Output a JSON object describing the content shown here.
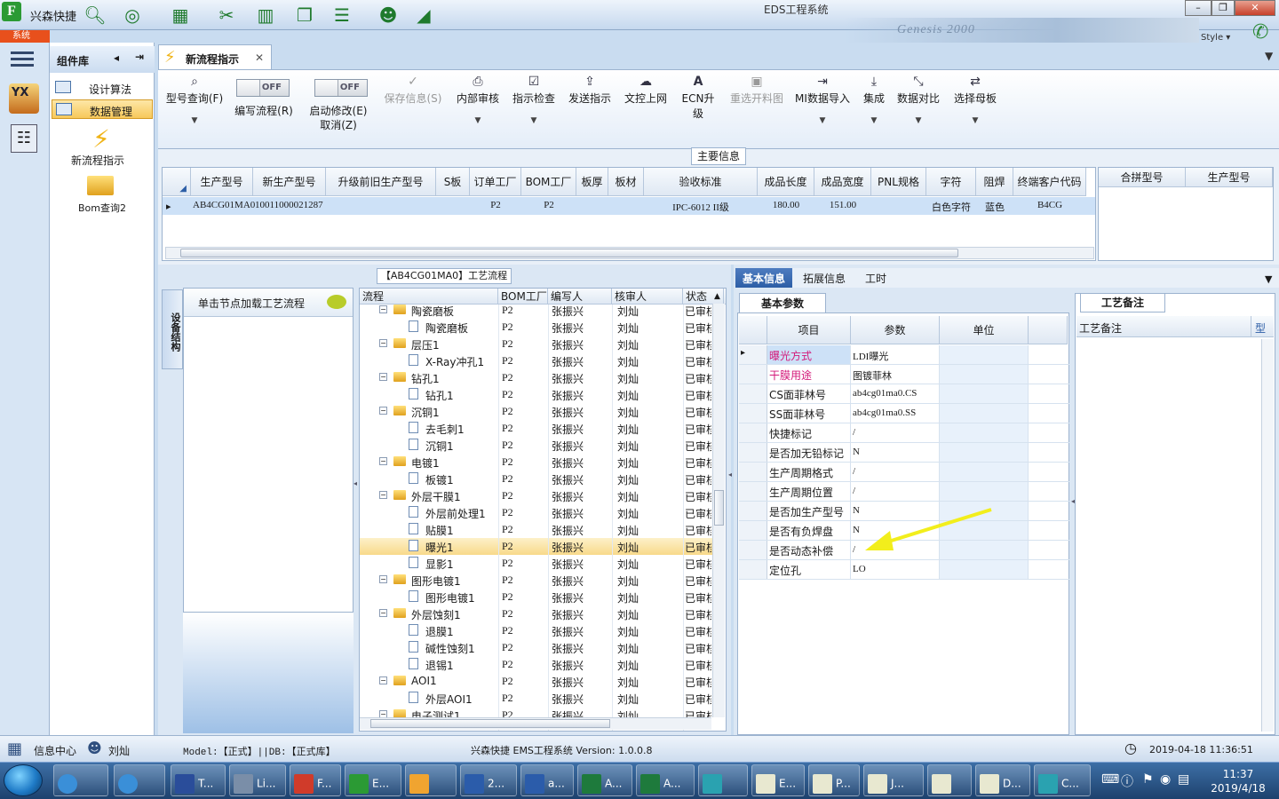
{
  "window": {
    "title": "EDS工程系统",
    "app_name": "兴森快捷",
    "style_label": "Style",
    "banner_text": "Genesis 2000"
  },
  "system_tab": "系统",
  "sidebar": {
    "header": "组件库",
    "items": [
      {
        "label": "设计算法",
        "selected": false
      },
      {
        "label": "数据管理",
        "selected": true
      }
    ],
    "tools": [
      {
        "label": "新流程指示"
      },
      {
        "label": "Bom查询2"
      }
    ]
  },
  "doc_tab": {
    "label": "新流程指示"
  },
  "ribbon": {
    "buttons": [
      {
        "label": "型号查询(F)",
        "icon": "search-icon",
        "enabled": true
      },
      {
        "label": "编写流程(R)",
        "toggle": "OFF",
        "enabled": true
      },
      {
        "label": "启动修改(E)",
        "toggle": "OFF",
        "sub": "取消(Z)",
        "enabled": true
      },
      {
        "label": "保存信息(S)",
        "icon": "check-icon",
        "enabled": false
      },
      {
        "label": "内部审核",
        "icon": "print-icon",
        "enabled": true
      },
      {
        "label": "指示检查",
        "icon": "checkbox-icon",
        "enabled": true
      },
      {
        "label": "发送指示",
        "icon": "upload-icon",
        "enabled": true
      },
      {
        "label": "文控上网",
        "icon": "cloud-upload-icon",
        "enabled": true
      },
      {
        "label": "ECN升级",
        "icon": "ecn-icon",
        "enabled": true
      },
      {
        "label": "重选开料图",
        "icon": "image-icon",
        "enabled": false
      },
      {
        "label": "MI数据导入",
        "icon": "import-icon",
        "enabled": true
      },
      {
        "label": "集成",
        "icon": "download-icon",
        "enabled": true
      },
      {
        "label": "数据对比",
        "icon": "compare-icon",
        "enabled": true
      },
      {
        "label": "选择母板",
        "icon": "shuffle-icon",
        "enabled": true
      }
    ]
  },
  "main_info": {
    "title": "主要信息",
    "columns": [
      "生产型号",
      "新生产型号",
      "升级前旧生产型号",
      "S板",
      "订单工厂",
      "BOM工厂",
      "板厚",
      "板材",
      "验收标准",
      "成品长度",
      "成品宽度",
      "PNL规格",
      "字符",
      "阻焊",
      "终端客户代码"
    ],
    "row": [
      "AB4CG01MA0",
      "10011000021287",
      "",
      "",
      "P2",
      "P2",
      "",
      "",
      "IPC-6012 II级",
      "180.00",
      "151.00",
      "",
      "白色字符",
      "蓝色",
      "B4CG"
    ],
    "side_columns": [
      "合拼型号",
      "生产型号"
    ]
  },
  "process": {
    "title": "【AB4CG01MA0】工艺流程",
    "vertical_tab": "设备结构",
    "left_header": "单击节点加载工艺流程",
    "columns": [
      "流程",
      "BOM工厂",
      "编写人",
      "核审人",
      "状态"
    ],
    "rows": [
      {
        "name": "陶瓷磨板",
        "level": 0,
        "bom": "P2",
        "author": "张振兴",
        "reviewer": "刘灿",
        "status": "已审核"
      },
      {
        "name": "陶瓷磨板",
        "level": 1,
        "bom": "P2",
        "author": "张振兴",
        "reviewer": "刘灿",
        "status": "已审核"
      },
      {
        "name": "层压1",
        "level": 0,
        "bom": "P2",
        "author": "张振兴",
        "reviewer": "刘灿",
        "status": "已审核"
      },
      {
        "name": "X-Ray冲孔1",
        "level": 1,
        "bom": "P2",
        "author": "张振兴",
        "reviewer": "刘灿",
        "status": "已审核"
      },
      {
        "name": "钻孔1",
        "level": 0,
        "bom": "P2",
        "author": "张振兴",
        "reviewer": "刘灿",
        "status": "已审核"
      },
      {
        "name": "钻孔1",
        "level": 1,
        "bom": "P2",
        "author": "张振兴",
        "reviewer": "刘灿",
        "status": "已审核"
      },
      {
        "name": "沉铜1",
        "level": 0,
        "bom": "P2",
        "author": "张振兴",
        "reviewer": "刘灿",
        "status": "已审核"
      },
      {
        "name": "去毛刺1",
        "level": 1,
        "bom": "P2",
        "author": "张振兴",
        "reviewer": "刘灿",
        "status": "已审核"
      },
      {
        "name": "沉铜1",
        "level": 1,
        "bom": "P2",
        "author": "张振兴",
        "reviewer": "刘灿",
        "status": "已审核"
      },
      {
        "name": "电镀1",
        "level": 0,
        "bom": "P2",
        "author": "张振兴",
        "reviewer": "刘灿",
        "status": "已审核"
      },
      {
        "name": "板镀1",
        "level": 1,
        "bom": "P2",
        "author": "张振兴",
        "reviewer": "刘灿",
        "status": "已审核"
      },
      {
        "name": "外层干膜1",
        "level": 0,
        "bom": "P2",
        "author": "张振兴",
        "reviewer": "刘灿",
        "status": "已审核"
      },
      {
        "name": "外层前处理1",
        "level": 1,
        "bom": "P2",
        "author": "张振兴",
        "reviewer": "刘灿",
        "status": "已审核"
      },
      {
        "name": "贴膜1",
        "level": 1,
        "bom": "P2",
        "author": "张振兴",
        "reviewer": "刘灿",
        "status": "已审核"
      },
      {
        "name": "曝光1",
        "level": 1,
        "bom": "P2",
        "author": "张振兴",
        "reviewer": "刘灿",
        "status": "已审核",
        "selected": true
      },
      {
        "name": "显影1",
        "level": 1,
        "bom": "P2",
        "author": "张振兴",
        "reviewer": "刘灿",
        "status": "已审核"
      },
      {
        "name": "图形电镀1",
        "level": 0,
        "bom": "P2",
        "author": "张振兴",
        "reviewer": "刘灿",
        "status": "已审核"
      },
      {
        "name": "图形电镀1",
        "level": 1,
        "bom": "P2",
        "author": "张振兴",
        "reviewer": "刘灿",
        "status": "已审核"
      },
      {
        "name": "外层蚀刻1",
        "level": 0,
        "bom": "P2",
        "author": "张振兴",
        "reviewer": "刘灿",
        "status": "已审核"
      },
      {
        "name": "退膜1",
        "level": 1,
        "bom": "P2",
        "author": "张振兴",
        "reviewer": "刘灿",
        "status": "已审核"
      },
      {
        "name": "碱性蚀刻1",
        "level": 1,
        "bom": "P2",
        "author": "张振兴",
        "reviewer": "刘灿",
        "status": "已审核"
      },
      {
        "name": "退锡1",
        "level": 1,
        "bom": "P2",
        "author": "张振兴",
        "reviewer": "刘灿",
        "status": "已审核"
      },
      {
        "name": "AOI1",
        "level": 0,
        "bom": "P2",
        "author": "张振兴",
        "reviewer": "刘灿",
        "status": "已审核"
      },
      {
        "name": "外层AOI1",
        "level": 1,
        "bom": "P2",
        "author": "张振兴",
        "reviewer": "刘灿",
        "status": "已审核"
      },
      {
        "name": "电子测试1",
        "level": 0,
        "bom": "P2",
        "author": "张振兴",
        "reviewer": "刘灿",
        "status": "已审核"
      }
    ]
  },
  "params": {
    "tabs": [
      "基本信息",
      "拓展信息",
      "工时"
    ],
    "active_tab": "基本信息",
    "subtab": "基本参数",
    "columns": [
      "项目",
      "参数",
      "单位"
    ],
    "rows": [
      {
        "key": "曝光方式",
        "value": "LDI曝光",
        "pink": true,
        "current": true
      },
      {
        "key": "干膜用途",
        "value": "图镀菲林",
        "pink": true
      },
      {
        "key": "CS面菲林号",
        "value": "ab4cg01ma0.CS"
      },
      {
        "key": "SS面菲林号",
        "value": "ab4cg01ma0.SS"
      },
      {
        "key": "快捷标记",
        "value": "/"
      },
      {
        "key": "是否加无铅标记",
        "value": "N"
      },
      {
        "key": "生产周期格式",
        "value": "/"
      },
      {
        "key": "生产周期位置",
        "value": "/"
      },
      {
        "key": "是否加生产型号",
        "value": "N"
      },
      {
        "key": "是否有负焊盘",
        "value": "N"
      },
      {
        "key": "是否动态补偿",
        "value": "/"
      },
      {
        "key": "定位孔",
        "value": "LO"
      }
    ],
    "remark_tab": "工艺备注",
    "remark_columns": [
      "工艺备注",
      "型"
    ]
  },
  "status": {
    "info_center": "信息中心",
    "user": "刘灿",
    "model_db": "Model:【正式】||DB:【正式库】",
    "version": "兴森快捷 EMS工程系统 Version: 1.0.0.8",
    "datetime": "2019-04-18 11:36:51"
  },
  "taskbar": {
    "items": [
      "T...",
      "Li...",
      "F...",
      "E...",
      "",
      "2...",
      "a...",
      "A...",
      "A...",
      "",
      "E...",
      "P...",
      "J...",
      "",
      "D...",
      "C..."
    ],
    "time": "11:37",
    "date": "2019/4/18"
  },
  "colors": {
    "accent": "#2c5ea6",
    "highlight": "#f8d98a",
    "pink_label": "#d3197a",
    "arrow": "#f2ee1c"
  }
}
